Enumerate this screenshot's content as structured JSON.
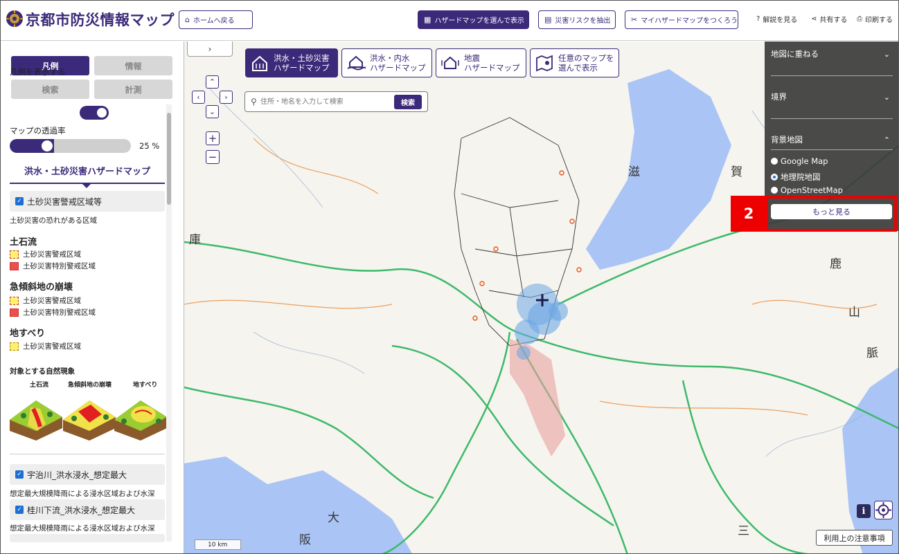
{
  "header": {
    "title": "京都市防災情報マップ",
    "home_button": "ホームへ戻る",
    "select_hazard_button": "ハザードマップを選んで表示",
    "extract_risk_button": "災害リスクを抽出",
    "my_hazard_button": "マイハザードマップをつくろう",
    "help_link": "解説を見る",
    "share_link": "共有する",
    "print_link": "印刷する"
  },
  "sidebar": {
    "tabs": [
      "凡例",
      "情報",
      "検索",
      "計測"
    ],
    "show_legend_label": "凡例を表示する",
    "show_legend_on": true,
    "opacity_label": "マップの透過率",
    "opacity_value": 25,
    "opacity_text": "25 %",
    "section_title": "洪水・土砂災害ハザードマップ",
    "layer1": {
      "label": "土砂災害警戒区域等",
      "checked": true
    },
    "layer1_desc": "土砂災害の恐れがある区域",
    "debris_flow": {
      "title": "土石流",
      "items": [
        "土砂災害警戒区域",
        "土砂災害特別警戒区域"
      ]
    },
    "steep_slope": {
      "title": "急傾斜地の崩壊",
      "items": [
        "土砂災害警戒区域",
        "土砂災害特別警戒区域"
      ]
    },
    "landslide": {
      "title": "地すべり",
      "items": [
        "土砂災害警戒区域"
      ]
    },
    "phenomena_title": "対象とする自然現象",
    "phenomena": [
      "土石流",
      "急傾斜地の崩壊",
      "地すべり"
    ],
    "layer2": {
      "label": "宇治川_洪水浸水_想定最大",
      "checked": true
    },
    "layer2_desc": "想定最大規模降雨による浸水区域および水深",
    "layer3": {
      "label": "桂川下流_洪水浸水_想定最大",
      "checked": true
    },
    "layer3_desc": "想定最大規模降雨による浸水区域および水深"
  },
  "map": {
    "collapse_icon": "chevron-right-icon",
    "tabs": [
      {
        "line1": "洪水・土砂災害",
        "line2": "ハザードマップ",
        "active": true
      },
      {
        "line1": "洪水・内水",
        "line2": "ハザードマップ",
        "active": false
      },
      {
        "line1": "地震",
        "line2": "ハザードマップ",
        "active": false
      },
      {
        "line1": "任意のマップを",
        "line2": "選んで表示",
        "active": false
      }
    ],
    "search": {
      "placeholder": "住所・地名を入力して検索",
      "button": "検索"
    },
    "labels": [
      "滋",
      "賀",
      "庫",
      "鹿",
      "山",
      "脈",
      "大",
      "阪",
      "三"
    ],
    "scale": "10 km",
    "notice_button": "利用上の注意事項"
  },
  "right_panel": {
    "overlay_title": "地図に重ねる",
    "boundary_title": "境界",
    "basemap_title": "背景地図",
    "basemap_options": [
      "Google Map",
      "地理院地図",
      "OpenStreetMap"
    ],
    "basemap_selected": "地理院地図",
    "more_button": "もっと見る"
  },
  "annotation": {
    "label": "2",
    "color": "#ee0000"
  },
  "colors": {
    "accent": "#3b2a7a",
    "water": "#a9c4f5",
    "road": "#3cb96a",
    "panel": "#3c3c3c"
  }
}
